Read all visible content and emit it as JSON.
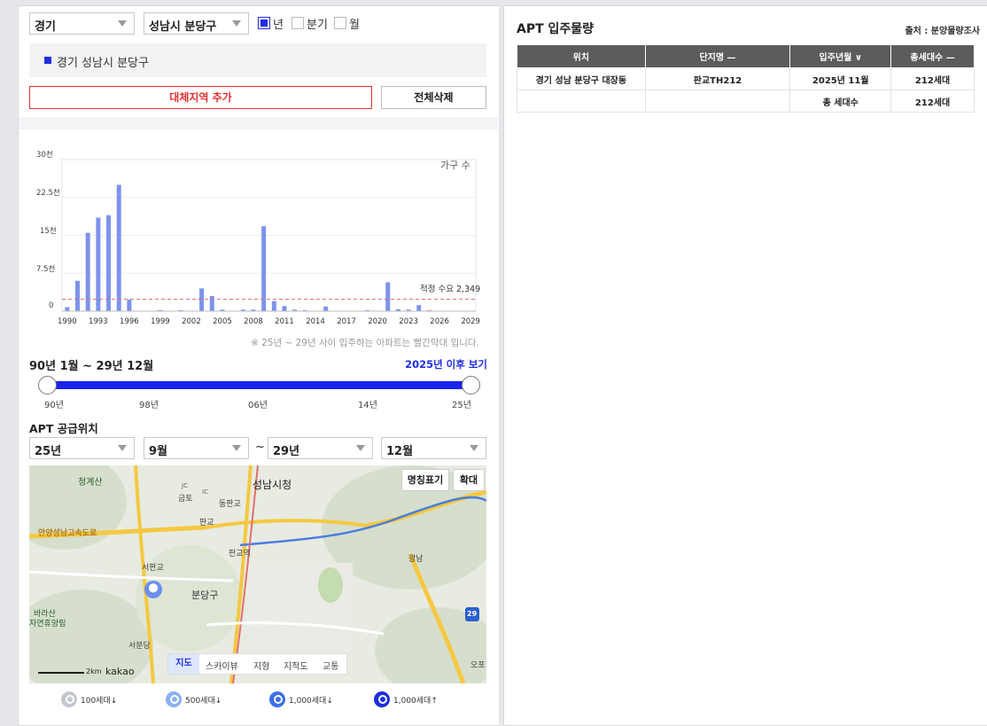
{
  "filters": {
    "province": "경기",
    "city": "성남시 분당구",
    "period_options": [
      {
        "label": "년",
        "checked": true
      },
      {
        "label": "분기",
        "checked": false
      },
      {
        "label": "월",
        "checked": false
      }
    ]
  },
  "selected_region": "경기 성남시 분당구",
  "buttons": {
    "add_alt_region": "대체지역 추가",
    "delete_all": "전체삭제"
  },
  "chart_data": {
    "type": "bar",
    "ylabel": "가구 수",
    "yticks": [
      "30천",
      "22.5천",
      "15천",
      "7.5천",
      "0"
    ],
    "ylim": [
      0,
      30000
    ],
    "xticks": [
      "1990",
      "1993",
      "1996",
      "1999",
      "2002",
      "2005",
      "2008",
      "2011",
      "2014",
      "2017",
      "2020",
      "2023",
      "2026",
      "2029"
    ],
    "x": [
      1990,
      1991,
      1992,
      1993,
      1994,
      1995,
      1996,
      1997,
      1998,
      1999,
      2000,
      2001,
      2002,
      2003,
      2004,
      2005,
      2006,
      2007,
      2008,
      2009,
      2010,
      2011,
      2012,
      2013,
      2014,
      2015,
      2016,
      2017,
      2018,
      2019,
      2020,
      2021,
      2022,
      2023,
      2024,
      2025
    ],
    "values": [
      800,
      6000,
      15500,
      18500,
      19000,
      25000,
      2300,
      0,
      0,
      200,
      0,
      200,
      100,
      4500,
      3000,
      300,
      0,
      300,
      300,
      16800,
      2000,
      1000,
      300,
      200,
      0,
      900,
      0,
      0,
      0,
      200,
      0,
      5700,
      400,
      300,
      1200,
      212
    ],
    "highlight_from": 2025,
    "colors": {
      "bar": "#7d93ec",
      "highlight": "#f28c8c",
      "refline": "#e36a6a"
    },
    "reference_line": {
      "label": "적정 수요 2,349",
      "value": 2349
    }
  },
  "chart_note": "※ 25년 ~ 29년 사이 입주하는 아파트는 빨간막대 입니다.",
  "period_range": "90년 1월 ~ 29년 12월",
  "view_after": "2025년 이후 보기",
  "slider": {
    "labels": [
      "90년",
      "98년",
      "06년",
      "14년",
      "25년"
    ],
    "start_fraction": 0,
    "end_fraction": 1
  },
  "supply_title": "APT 공급위치",
  "supply_filter": {
    "from_year": "25년",
    "from_month": "9월",
    "tilde": "~",
    "to_year": "29년",
    "to_month": "12월"
  },
  "map": {
    "name_btn": "명칭표기",
    "zoom_btn": "확대",
    "types": [
      "지도",
      "스카이뷰",
      "지형",
      "지적도",
      "교통"
    ],
    "scale": "2km",
    "brand": "kakao",
    "labels": [
      "청계산",
      "성남시청",
      "금토",
      "동판교",
      "판교",
      "판교역",
      "서판교",
      "분당구",
      "바라산",
      "자연휴양림",
      "서분당",
      "광남",
      "오포",
      "안양성남고속도로",
      "29",
      "IC",
      "JC"
    ]
  },
  "legend": [
    {
      "label": "100세대↓",
      "color": "#c4c7cc"
    },
    {
      "label": "500세대↓",
      "color": "#8ab0f2"
    },
    {
      "label": "1,000세대↓",
      "color": "#3d6ee8"
    },
    {
      "label": "1,000세대↑",
      "color": "#1f2ee0"
    }
  ],
  "right": {
    "title": "APT 입주물량",
    "source": "출처 : 분양물량조사",
    "headers": [
      "위치",
      "단지명 —",
      "입주년월 ∨",
      "총세대수 —"
    ],
    "row": {
      "location": "경기 성남 분당구 대장동",
      "complex": "판교TH212",
      "date": "2025년 11월",
      "units": "212세대"
    },
    "total": {
      "label": "총 세대수",
      "value": "212세대"
    }
  }
}
